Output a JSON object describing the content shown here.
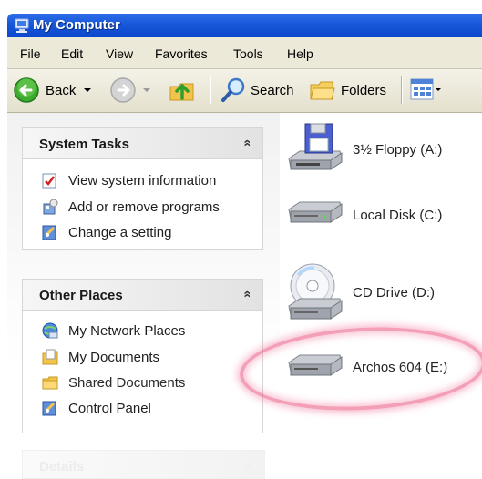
{
  "window": {
    "title": "My Computer"
  },
  "menu": {
    "items": [
      "File",
      "Edit",
      "View",
      "Favorites",
      "Tools",
      "Help"
    ]
  },
  "toolbar": {
    "back_label": "Back",
    "search_label": "Search",
    "folders_label": "Folders"
  },
  "left_pane": {
    "system_tasks": {
      "title": "System Tasks",
      "collapse_glyph": "»",
      "items": [
        "View system information",
        "Add or remove programs",
        "Change a setting"
      ]
    },
    "other_places": {
      "title": "Other Places",
      "collapse_glyph": "»",
      "items": [
        "My Network Places",
        "My Documents",
        "Shared Documents",
        "Control Panel"
      ]
    },
    "details": {
      "title": "Details",
      "collapse_glyph": "»"
    }
  },
  "drives": [
    {
      "label": "3½ Floppy (A:)",
      "icon": "floppy-drive-icon"
    },
    {
      "label": "Local Disk (C:)",
      "icon": "hard-disk-icon"
    },
    {
      "label": "CD Drive (D:)",
      "icon": "cd-drive-icon"
    },
    {
      "label": "Archos 604 (E:)",
      "icon": "removable-disk-icon"
    }
  ],
  "colors": {
    "title_bar": "#1857d8",
    "highlight_ring": "#eb507d",
    "chrome": "#ece9d8"
  }
}
